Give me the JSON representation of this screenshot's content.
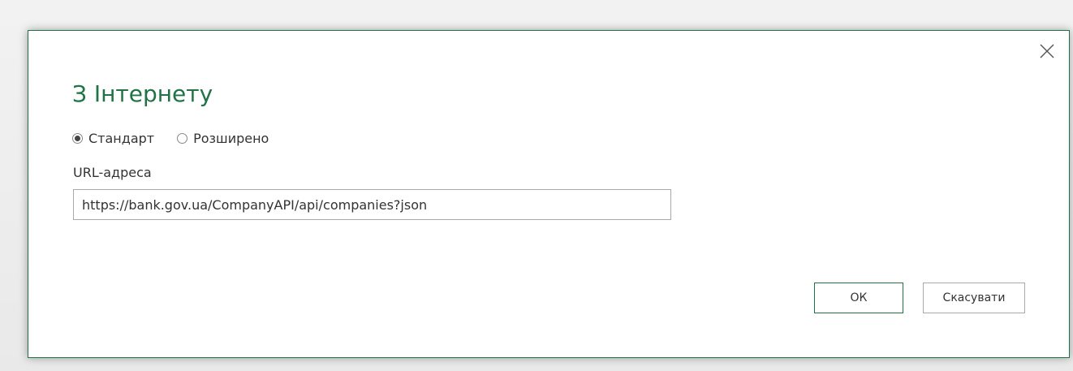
{
  "dialog": {
    "title": "З Інтернету",
    "modes": [
      {
        "label": "Стандарт",
        "selected": true
      },
      {
        "label": "Розширено",
        "selected": false
      }
    ],
    "url": {
      "label": "URL-адреса",
      "value": "https://bank.gov.ua/CompanyAPI/api/companies?json"
    },
    "buttons": {
      "ok": "ОК",
      "cancel": "Скасувати"
    }
  },
  "icons": {
    "close": "close-icon",
    "radio_selected": "radio-selected-icon",
    "radio_unselected": "radio-unselected-icon"
  },
  "colors": {
    "accent": "#217346",
    "text": "#333333",
    "border": "#aaaaaa"
  }
}
